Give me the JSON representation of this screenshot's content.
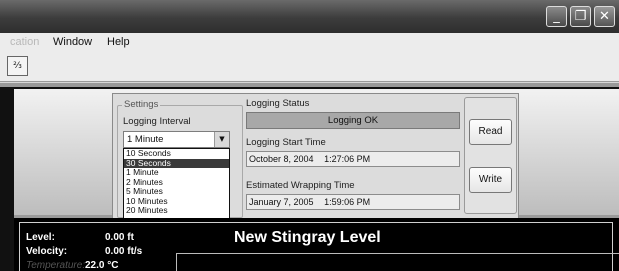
{
  "window": {
    "minimize_glyph": "_",
    "restore_glyph": "❐",
    "close_glyph": "✕"
  },
  "menu": {
    "partial_item": "cation",
    "window": "Window",
    "help": "Help"
  },
  "toolbar": {
    "icon_glyph": "⅔"
  },
  "settings": {
    "legend": "Settings",
    "interval_label": "Logging Interval",
    "interval_value": "1 Minute",
    "interval_options": [
      "10 Seconds",
      "30 Seconds",
      "1 Minute",
      "2 Minutes",
      "5 Minutes",
      "10 Minutes",
      "20 Minutes"
    ],
    "highlighted_option": "30 Seconds"
  },
  "status": {
    "status_label": "Logging Status",
    "status_value": "Logging OK",
    "start_label": "Logging Start Time",
    "start_date": "October 8, 2004",
    "start_time": "1:27:06 PM",
    "wrap_label": "Estimated Wrapping Time",
    "wrap_date": "January 7, 2005",
    "wrap_time": "1:59:06 PM"
  },
  "buttons": {
    "read": "Read",
    "write": "Write"
  },
  "readouts": {
    "level_label": "Level:",
    "level_value": "0.00 ft",
    "velocity_label": "Velocity:",
    "velocity_value": "0.00 ft/s",
    "temperature_label": "Temperature:",
    "temperature_value": "22.0 °C"
  },
  "device_title": "New Stingray Level"
}
